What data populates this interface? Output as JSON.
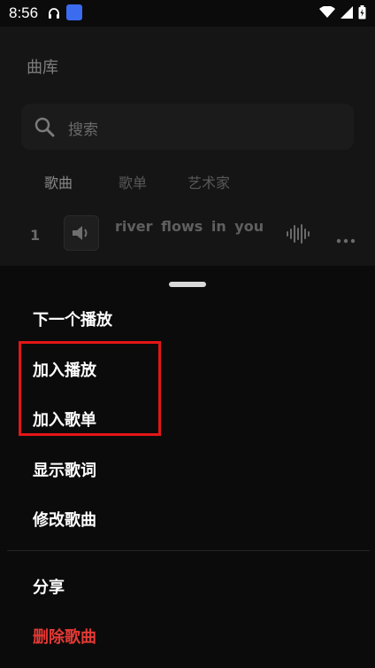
{
  "status_bar": {
    "time": "8:56",
    "icons": [
      "headphones-icon",
      "app-notification-icon",
      "wifi-icon",
      "signal-icon",
      "battery-icon"
    ]
  },
  "library": {
    "title": "曲库",
    "search_placeholder": "搜索",
    "tabs": [
      {
        "label": "歌曲",
        "active": true
      },
      {
        "label": "歌单",
        "active": false
      },
      {
        "label": "艺术家",
        "active": false
      }
    ],
    "song": {
      "index": "1",
      "title": "river flows in you"
    }
  },
  "sheet": {
    "items": [
      {
        "label": "下一个播放"
      },
      {
        "label": "加入播放"
      },
      {
        "label": "加入歌单"
      },
      {
        "label": "显示歌词"
      },
      {
        "label": "修改歌曲"
      },
      {
        "label": "分享"
      },
      {
        "label": "删除歌曲",
        "danger": true
      }
    ],
    "highlight_color": "#e41616",
    "danger_color": "#e53935"
  }
}
